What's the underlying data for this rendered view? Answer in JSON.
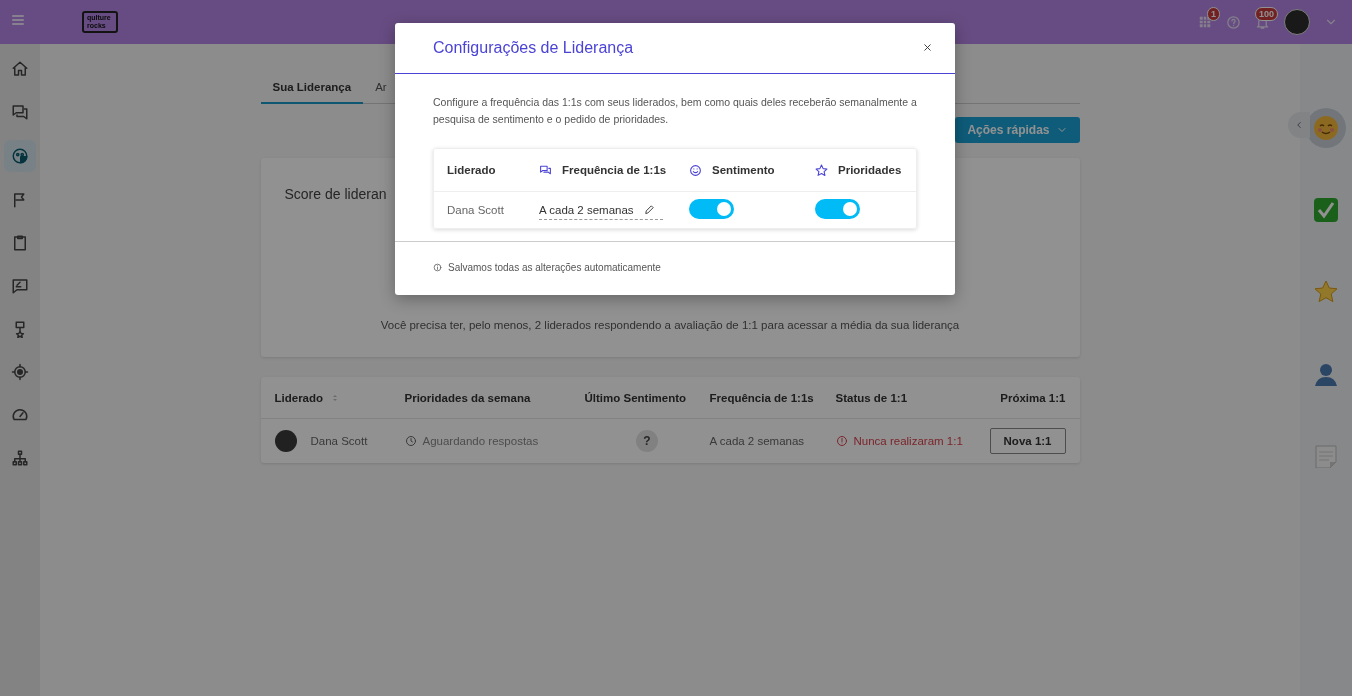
{
  "topbar": {
    "logo": "qulture rocks",
    "apps_badge": "1",
    "notifications_badge": "100"
  },
  "sidebar": {
    "items": [
      {
        "kind": "home",
        "selected": false
      },
      {
        "kind": "chat",
        "selected": false
      },
      {
        "kind": "mood",
        "selected": true
      },
      {
        "kind": "flag",
        "selected": false
      },
      {
        "kind": "clipboard",
        "selected": false
      },
      {
        "kind": "feedback",
        "selected": false
      },
      {
        "kind": "award",
        "selected": false
      },
      {
        "kind": "target",
        "selected": false
      },
      {
        "kind": "gauge",
        "selected": false
      },
      {
        "kind": "org",
        "selected": false
      }
    ]
  },
  "tabs": [
    {
      "label": "Sua Liderança",
      "selected": true
    },
    {
      "label": "Ar",
      "selected": false
    }
  ],
  "quick_actions": {
    "label": "Ações rápidas"
  },
  "score_card": {
    "title": "Score de lideran",
    "message": "Você precisa ter, pelo menos, 2 liderados respondendo a avaliação de 1:1 para acessar a média da sua liderança"
  },
  "table": {
    "columns": [
      {
        "label": "Liderado",
        "sortable": true
      },
      {
        "label": "Prioridades da semana",
        "sortable": false
      },
      {
        "label": "Último Sentimento",
        "sortable": false
      },
      {
        "label": "Frequência de 1:1s",
        "sortable": false
      },
      {
        "label": "Status de 1:1",
        "sortable": false
      },
      {
        "label": "Próxima 1:1",
        "sortable": false
      }
    ],
    "rows": [
      {
        "name": "Dana Scott",
        "priorities": "Aguardando respostas",
        "sentiment": "?",
        "frequency": "A cada 2 semanas",
        "status": "Nunca realizaram 1:1",
        "action": "Nova 1:1"
      }
    ]
  },
  "side_panel": {
    "items": [
      {
        "kind": "smile",
        "selected": true
      },
      {
        "kind": "check",
        "selected": false
      },
      {
        "kind": "star",
        "selected": false
      },
      {
        "kind": "person",
        "selected": false
      },
      {
        "kind": "notepad",
        "selected": false
      }
    ]
  },
  "modal": {
    "title": "Configurações de Liderança",
    "description": "Configure a frequência das 1:1s com seus liderados, bem como quais deles receberão semanalmente a pesquisa de sentimento e o pedido de prioridades.",
    "columns": [
      {
        "label": "Liderado",
        "kind": "none"
      },
      {
        "label": "Frequência de 1:1s",
        "kind": "chat"
      },
      {
        "label": "Sentimento",
        "kind": "smile"
      },
      {
        "label": "Prioridades",
        "kind": "star"
      }
    ],
    "rows": [
      {
        "name": "Dana Scott",
        "frequency": "A cada 2 semanas",
        "sentiment": true,
        "priorities": true
      }
    ],
    "footer": "Salvamos todas as alterações automaticamente"
  }
}
